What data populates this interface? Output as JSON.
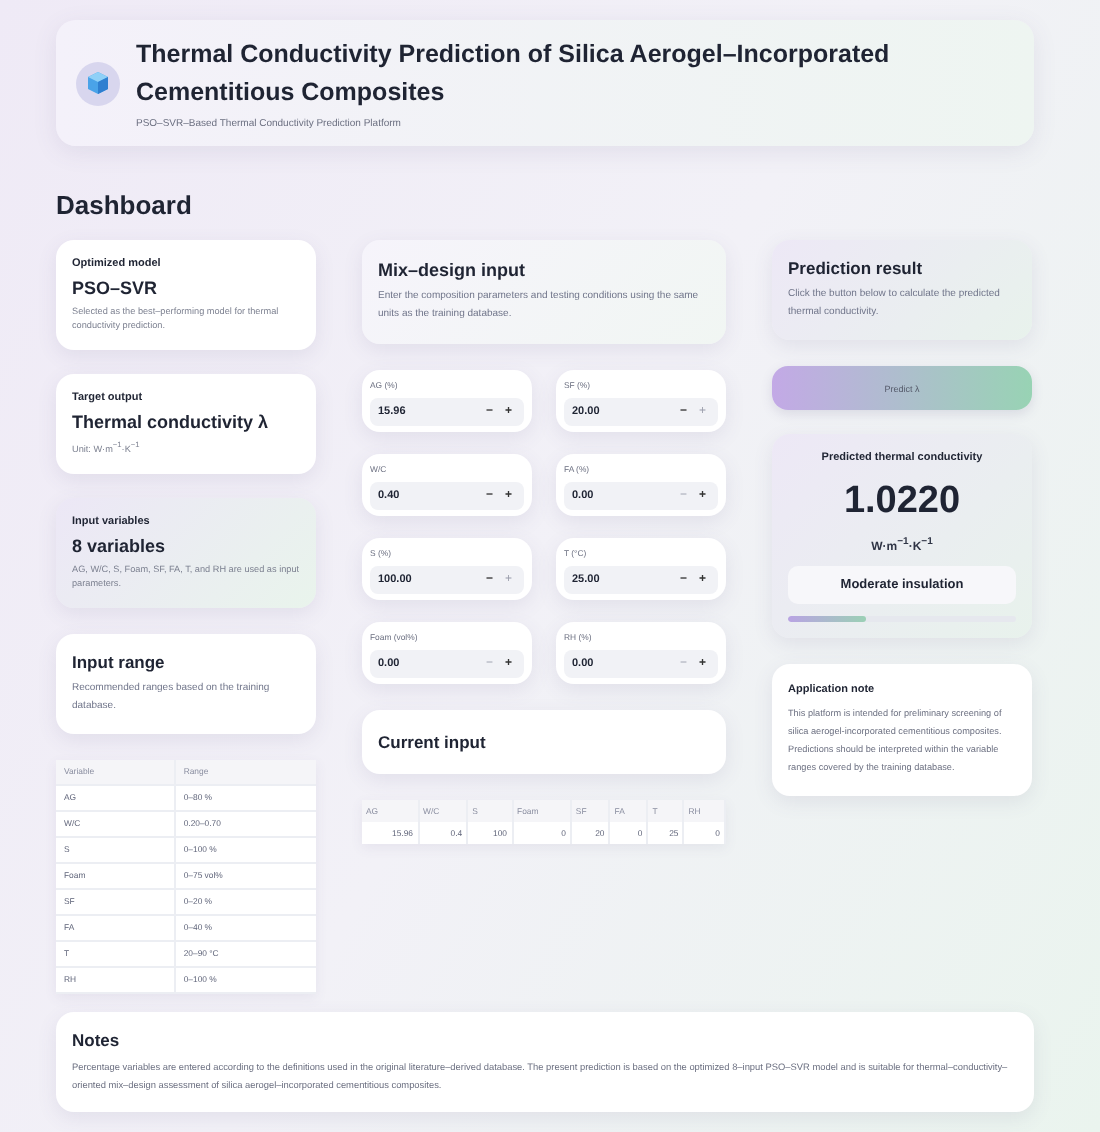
{
  "header": {
    "title": "Thermal Conductivity Prediction of Silica Aerogel–Incorporated Cementitious Composites",
    "subtitle": "PSO–SVR–Based Thermal Conductivity Prediction Platform"
  },
  "page_title": "Dashboard",
  "info_cards": [
    {
      "label": "Optimized model",
      "value": "PSO–SVR",
      "description": "Selected as the best–performing model for thermal conductivity prediction.",
      "highlighted": false
    },
    {
      "label": "Target output",
      "value": "Thermal conductivity λ",
      "description": "Unit: W·m$^{−1}$·K$^{−1}$",
      "highlighted": false
    },
    {
      "label": "Input variables",
      "value": "8 variables",
      "description": "AG, W/C, S, Foam, SF, FA, T, and RH are used as input parameters.",
      "highlighted": true
    }
  ],
  "input_range": {
    "title": "Input range",
    "description": "Recommended ranges based on the training database.",
    "columns": [
      "Variable",
      "Range"
    ],
    "rows": [
      [
        "AG",
        "0–80 %"
      ],
      [
        "W/C",
        "0.20–0.70"
      ],
      [
        "S",
        "0–100 %"
      ],
      [
        "Foam",
        "0–75 vol%"
      ],
      [
        "SF",
        "0–20 %"
      ],
      [
        "FA",
        "0–40 %"
      ],
      [
        "T",
        "20–90 °C"
      ],
      [
        "RH",
        "0–100 %"
      ]
    ]
  },
  "mix_design": {
    "title": "Mix–design input",
    "description": "Enter the composition parameters and testing conditions using the same units as the training database.",
    "fields": [
      {
        "label": "AG (%)",
        "value": "15.96",
        "minus_disabled": false,
        "plus_disabled": false
      },
      {
        "label": "SF (%)",
        "value": "20.00",
        "minus_disabled": false,
        "plus_disabled": true
      },
      {
        "label": "W/C",
        "value": "0.40",
        "minus_disabled": false,
        "plus_disabled": false
      },
      {
        "label": "FA (%)",
        "value": "0.00",
        "minus_disabled": true,
        "plus_disabled": false
      },
      {
        "label": "S (%)",
        "value": "100.00",
        "minus_disabled": false,
        "plus_disabled": true
      },
      {
        "label": "T (°C)",
        "value": "25.00",
        "minus_disabled": false,
        "plus_disabled": false
      },
      {
        "label": "Foam (vol%)",
        "value": "0.00",
        "minus_disabled": true,
        "plus_disabled": false
      },
      {
        "label": "RH (%)",
        "value": "0.00",
        "minus_disabled": true,
        "plus_disabled": false
      }
    ],
    "minus": "−",
    "plus": "+"
  },
  "current_input": {
    "title": "Current input",
    "columns": [
      "AG",
      "W/C",
      "S",
      "Foam",
      "SF",
      "FA",
      "T",
      "RH"
    ],
    "values": [
      "15.96",
      "0.4",
      "100",
      "0",
      "20",
      "0",
      "25",
      "0"
    ]
  },
  "prediction": {
    "title": "Prediction result",
    "description": "Click the button below to calculate the predicted thermal conductivity.",
    "button": "Predict λ",
    "result": {
      "label": "Predicted thermal conductivity",
      "value": "1.0220",
      "unit": "W·m$^{−1}$·K$^{−1}$",
      "category": "Moderate insulation",
      "level": 0.34
    }
  },
  "application_note": {
    "title": "Application note",
    "text": "This platform is intended for preliminary screening of silica aerogel-incorporated cementitious composites. Predictions should be interpreted within the variable ranges covered by the training database."
  },
  "notes": {
    "title": "Notes",
    "text": "Percentage variables are entered according to the definitions used in the original literature–derived database. The present prediction is based on the optimized 8–input PSO–SVR model and is suitable for thermal–conductivity–oriented mix–design assessment of silica aerogel–incorporated cementitious composites."
  }
}
